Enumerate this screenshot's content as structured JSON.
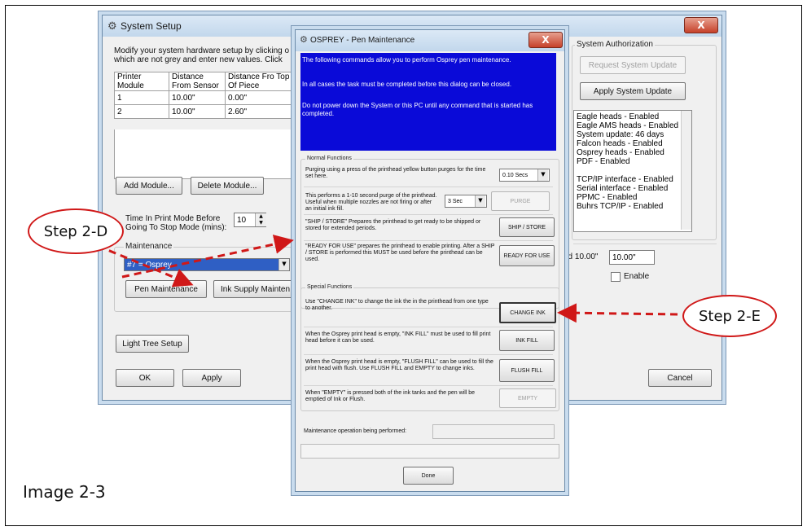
{
  "caption": "Image 2-3",
  "callouts": {
    "step_d": "Step 2-D",
    "step_e": "Step 2-E"
  },
  "colors": {
    "accent_blue": "#0a0ad8",
    "callout_red": "#d01818"
  },
  "system_setup": {
    "title": "System Setup",
    "title_icon": "gear-icon",
    "close": "X",
    "intro": "Modify your system hardware setup by clicking o which are not grey and enter new values. Click",
    "table_headers": [
      "Printer Module",
      "Distance From Sensor",
      "Distance Fro Top Of Piece"
    ],
    "rows": [
      [
        "1",
        "10.00\"",
        "0.00\""
      ],
      [
        "2",
        "10.00\"",
        "2.60\""
      ]
    ],
    "add_module": "Add Module...",
    "delete_module": "Delete Module...",
    "time_label": "Time In Print Mode Before Going To Stop Mode (mins):",
    "time_value": "10",
    "maintenance_label": "Maintenance",
    "maintenance_select": "#7 = Osprey",
    "pen_maintenance": "Pen Maintenance",
    "ink_supply": "Ink Supply Mainten",
    "light_tree": "Light Tree Setup",
    "ok": "OK",
    "apply": "Apply",
    "cancel": "Cancel",
    "auth_label": "System Authorization",
    "request_update": "Request System Update",
    "apply_update": "Apply System Update",
    "auth_list": [
      "Eagle heads - Enabled",
      "Eagle AMS heads - Enabled",
      "System update: 46 days",
      "Falcon heads - Enabled",
      "Osprey heads - Enabled",
      "PDF - Enabled",
      "",
      "TCP/IP interface - Enabled",
      "Serial interface - Enabled",
      "PPMC - Enabled",
      "Buhrs TCP/IP - Enabled"
    ],
    "distance_label": "ed 10.00\"",
    "distance_value": "10.00\"",
    "enable": "Enable"
  },
  "pen_dialog": {
    "title": "OSPREY - Pen Maintenance",
    "close": "X",
    "info": [
      "The following commands allow you to perform Osprey pen maintenance.",
      "In all cases the task must be completed before this dialog can be closed.",
      "Do not power down the System or this PC until any command that is started has completed."
    ],
    "normal_label": "Normal Functions",
    "purge_time_text": "Purging using a press of the printhead yellow button purges for the time set here.",
    "purge_time_value": "0.10 Secs",
    "purge_text": "This performs a 1-10 second purge of the printhead.  Useful when multiple nozzles are not firing or after an initial ink fill.",
    "purge_value": "3 Sec",
    "purge_btn": "PURGE",
    "ship_text": "\"SHIP / STORE\" Prepares the printhead to get ready to be shipped or stored for extended periods.",
    "ship_btn": "SHIP / STORE",
    "ready_text": "\"READY FOR USE\" prepares the printhead to enable printing.  After a SHIP / STORE is performed this MUST be used before the printhead can be used.",
    "ready_btn": "READY FOR USE",
    "special_label": "Special Functions",
    "change_text": "Use \"CHANGE INK\" to change the ink the in the printhead from one type to another.",
    "change_btn": "CHANGE INK",
    "fill_text": "When the Osprey print head is empty, \"INK FILL\" must be used to fill print head before it can be used.",
    "fill_btn": "INK FILL",
    "flush_text": "When the Osprey print head is empty, \"FLUSH FILL\" can be used to fill the print head with flush.  Use FLUSH FILL and EMPTY to change inks.",
    "flush_btn": "FLUSH FILL",
    "empty_text": "When \"EMPTY\" is pressed both of the ink tanks and the pen will be emptied of Ink or Flush.",
    "empty_btn": "EMPTY",
    "operation_label": "Maintenance operation being performed:",
    "done": "Done"
  }
}
